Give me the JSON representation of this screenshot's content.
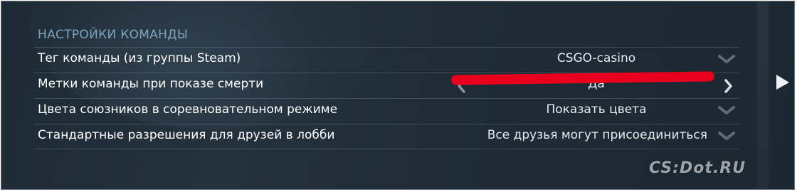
{
  "section": {
    "title": "НАСТРОЙКИ КОМАНДЫ"
  },
  "settings": [
    {
      "label": "Тег команды (из группы Steam)",
      "value": "CSGO-casino",
      "control": "dropdown"
    },
    {
      "label": "Метки команды при показе смерти",
      "value": "Да",
      "control": "arrows"
    },
    {
      "label": "Цвета союзников в соревновательном режиме",
      "value": "Показать цвета",
      "control": "dropdown"
    },
    {
      "label": "Стандартные разрешения для друзей в лобби",
      "value": "Все друзья могут присоединиться",
      "control": "dropdown"
    }
  ],
  "icons": {
    "dropdown": "chevron-down-icon",
    "prev": "chevron-left-icon",
    "next": "chevron-right-icon",
    "cursor": "play-arrow-icon"
  },
  "colors": {
    "background": "#1f2c37",
    "section_title": "#7fa3bd",
    "text": "#ffffff",
    "annotation_mark": "#e8001c"
  },
  "watermark": {
    "text": "CS:Dot.RU"
  }
}
